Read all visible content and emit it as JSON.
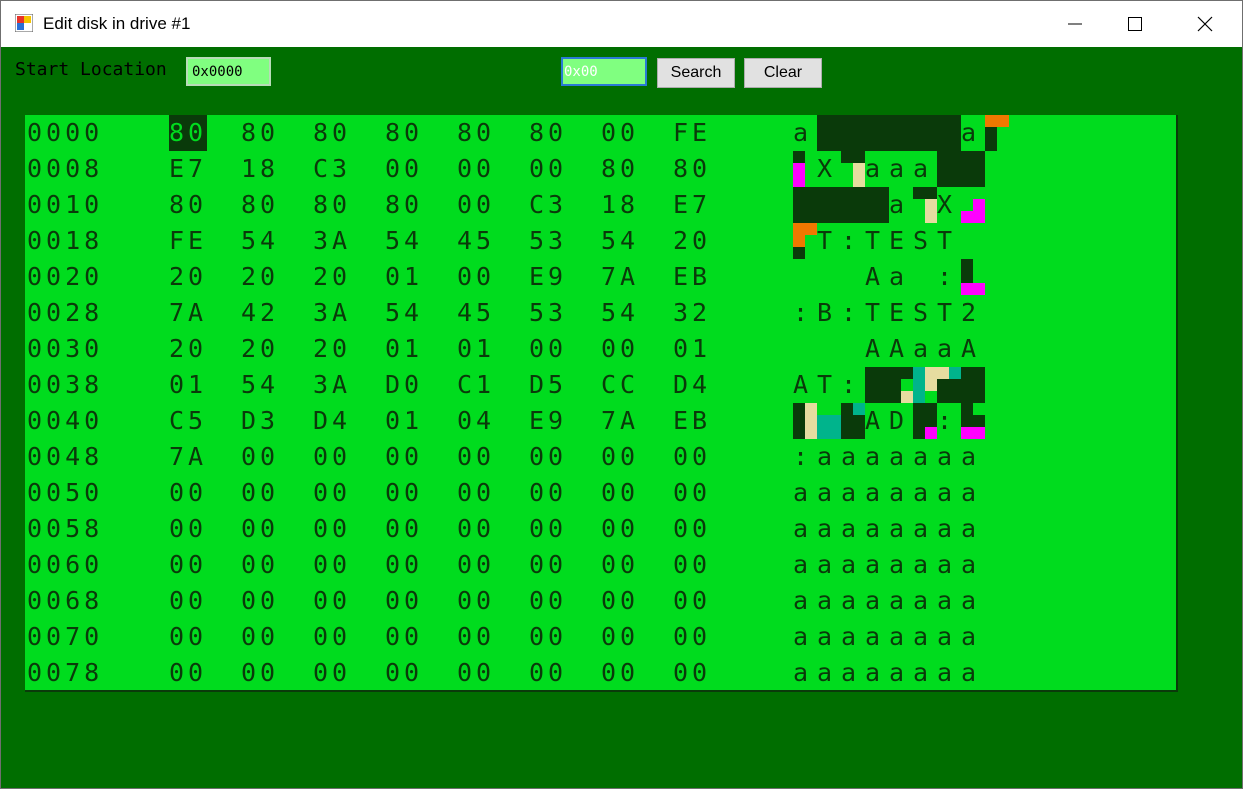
{
  "window": {
    "title": "Edit disk in drive #1"
  },
  "controls": {
    "start_label": "Start Location",
    "start_value": "0x0000",
    "search_value": "0x00",
    "search_button": "Search",
    "clear_button": "Clear"
  },
  "colors": {
    "window_bg": "#006e00",
    "panel_bg": "#00dc1e",
    "ink": "#0a3a0a",
    "input_bg": "#80ff80",
    "magenta": "#ff00ff",
    "orange": "#f07800",
    "cream": "#e6dca0",
    "teal": "#00b48c"
  },
  "selected": {
    "row": 0,
    "col": 0
  },
  "hex": {
    "rows": [
      {
        "addr": "0000",
        "bytes": [
          "80",
          "80",
          "80",
          "80",
          "80",
          "80",
          "00",
          "FE"
        ],
        "ascii": "a@@@@@@a@"
      },
      {
        "addr": "0008",
        "bytes": [
          "E7",
          "18",
          "C3",
          "00",
          "00",
          "00",
          "80",
          "80"
        ],
        "ascii": "@X@aaa@@"
      },
      {
        "addr": "0010",
        "bytes": [
          "80",
          "80",
          "80",
          "80",
          "00",
          "C3",
          "18",
          "E7"
        ],
        "ascii": "@@@@a@X@"
      },
      {
        "addr": "0018",
        "bytes": [
          "FE",
          "54",
          "3A",
          "54",
          "45",
          "53",
          "54",
          "20"
        ],
        "ascii": "@T:TEST "
      },
      {
        "addr": "0020",
        "bytes": [
          "20",
          "20",
          "20",
          "01",
          "00",
          "E9",
          "7A",
          "EB"
        ],
        "ascii": "   Aa@:@"
      },
      {
        "addr": "0028",
        "bytes": [
          "7A",
          "42",
          "3A",
          "54",
          "45",
          "53",
          "54",
          "32"
        ],
        "ascii": ":B:TEST2"
      },
      {
        "addr": "0030",
        "bytes": [
          "20",
          "20",
          "20",
          "01",
          "01",
          "00",
          "00",
          "01"
        ],
        "ascii": "   AAaaA"
      },
      {
        "addr": "0038",
        "bytes": [
          "01",
          "54",
          "3A",
          "D0",
          "C1",
          "D5",
          "CC",
          "D4"
        ],
        "ascii": "AT:@@@@@"
      },
      {
        "addr": "0040",
        "bytes": [
          "C5",
          "D3",
          "D4",
          "01",
          "04",
          "E9",
          "7A",
          "EB"
        ],
        "ascii": "@@@AD@:@"
      },
      {
        "addr": "0048",
        "bytes": [
          "7A",
          "00",
          "00",
          "00",
          "00",
          "00",
          "00",
          "00"
        ],
        "ascii": ":aaaaaaa"
      },
      {
        "addr": "0050",
        "bytes": [
          "00",
          "00",
          "00",
          "00",
          "00",
          "00",
          "00",
          "00"
        ],
        "ascii": "aaaaaaaa"
      },
      {
        "addr": "0058",
        "bytes": [
          "00",
          "00",
          "00",
          "00",
          "00",
          "00",
          "00",
          "00"
        ],
        "ascii": "aaaaaaaa"
      },
      {
        "addr": "0060",
        "bytes": [
          "00",
          "00",
          "00",
          "00",
          "00",
          "00",
          "00",
          "00"
        ],
        "ascii": "aaaaaaaa"
      },
      {
        "addr": "0068",
        "bytes": [
          "00",
          "00",
          "00",
          "00",
          "00",
          "00",
          "00",
          "00"
        ],
        "ascii": "aaaaaaaa"
      },
      {
        "addr": "0070",
        "bytes": [
          "00",
          "00",
          "00",
          "00",
          "00",
          "00",
          "00",
          "00"
        ],
        "ascii": "aaaaaaaa"
      },
      {
        "addr": "0078",
        "bytes": [
          "00",
          "00",
          "00",
          "00",
          "00",
          "00",
          "00",
          "00"
        ],
        "ascii": "aaaaaaaa"
      }
    ]
  }
}
